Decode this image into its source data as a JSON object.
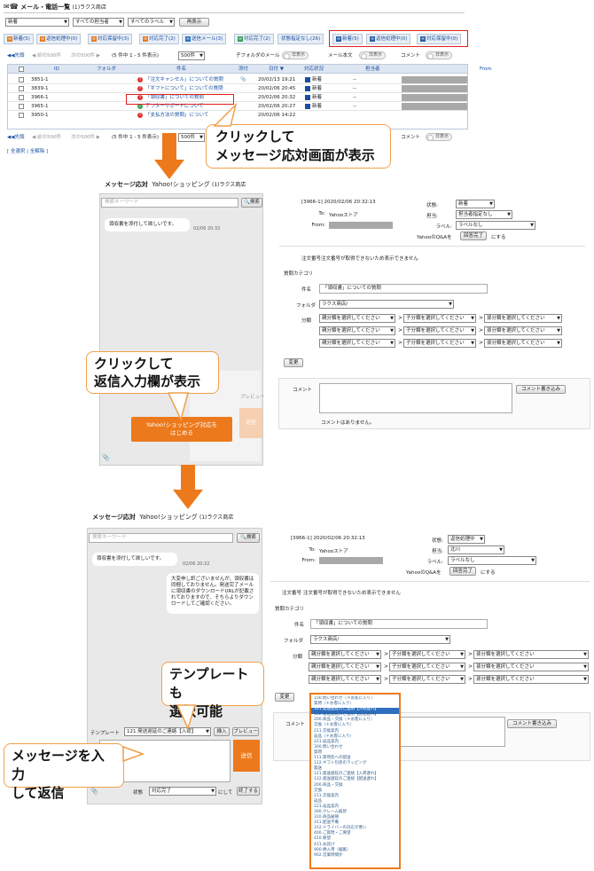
{
  "header": {
    "title": "メール・電話一覧",
    "shop": "(1)ラクス商店"
  },
  "filters": {
    "category": "新着",
    "assignee": "すべての担当者",
    "label": "すべてのラベル",
    "redisplay": "再表示"
  },
  "tabs": [
    {
      "label": "新着(5)"
    },
    {
      "label": "返信処理中(0)"
    },
    {
      "label": "対応保留中(3)"
    },
    {
      "label": "対応完了(2)"
    },
    {
      "label": "送信メール(3)"
    },
    {
      "label": "対応完了(2)"
    },
    {
      "label": "状態指定なし(26)"
    },
    {
      "label": "新着(5)"
    },
    {
      "label": "返信処理中(0)"
    },
    {
      "label": "対応保留中(0)"
    }
  ],
  "pager": {
    "first": "先頭",
    "prev": "前の500件",
    "next": "次の500件",
    "range": "(5 件中 1 - 5 件表示)",
    "per_page": "500件",
    "subfolder": "子フォルダのメール",
    "body_label": "メール本文",
    "comment_label": "コメント",
    "hidden": "非表示"
  },
  "table": {
    "headers": [
      "ID",
      "フォルダ",
      "件名",
      "添付",
      "日付 ▼",
      "対応状況",
      "担当者",
      "From"
    ],
    "rows": [
      {
        "id": "3851-1",
        "subject": "「注文キャンセル」についての質問",
        "date": "20/02/13 19:21",
        "status": "新着",
        "assignee": "--"
      },
      {
        "id": "3839-1",
        "subject": "「ギフトについて」についての質問",
        "date": "20/02/06 20:45",
        "status": "新着",
        "assignee": "--"
      },
      {
        "id": "3966-1",
        "subject": "「領収書」についての質問",
        "date": "20/02/06 20:32",
        "status": "新着",
        "assignee": "--"
      },
      {
        "id": "3965-1",
        "subject": "アフターサポートについて",
        "date": "20/02/06 20:27",
        "status": "新着",
        "assignee": "--"
      },
      {
        "id": "3950-1",
        "subject": "「支払方法の質問」について",
        "date": "20/02/06 14:22",
        "status": "新着",
        "assignee": "--"
      }
    ]
  },
  "select_links": "[ 全選択 | 全解除 ]",
  "callouts": {
    "c1": "クリックして\nメッセージ応対画面が表示",
    "c2": "クリックして\n返信入力欄が表示",
    "c3": "テンプレートも\n選択可能",
    "c4": "メッセージを入力\nして返信"
  },
  "panel1": {
    "title": "メッセージ応対",
    "store": "Yahoo!ショッピング",
    "shop": "(1)ラクス商店",
    "search_placeholder": "検索キーワード",
    "search_btn": "検索",
    "customer_msg": "領収書を添付して欲しいです。",
    "msg_time": "02/06 20:32",
    "start_btn": "Yahoo!ショッピング対応を\nはじめる",
    "tpl_btn": "挿入",
    "preview_btn": "プレビュー",
    "send_btn": "送信"
  },
  "detail1": {
    "id_date": "[3966-1]  2020/02/06 20:32:13",
    "to_label": "To:",
    "to": "Yahooストア",
    "from_label": "From:",
    "status_label": "状態:",
    "status": "新着",
    "assignee_label": "担当:",
    "assignee": "担当者指定なし",
    "label_label": "ラベル:",
    "label": "ラベルなし",
    "qa_label": "YahooのQ&Aを",
    "qa_btn": "回答完了",
    "qa_suffix": "にする",
    "order_label": "注文番号",
    "order_msg": "注文番号が取得できないため表示できません",
    "category_title": "質問カテゴリ",
    "subject_label": "件名",
    "subject": "「領収書」についての質問",
    "folder_label": "フォルダ",
    "folder": "ラクス商店/",
    "class_label": "分類",
    "major": "親分類を選択してください",
    "minor": "子分類を選択してください",
    "grand": "孫分類を選択してください",
    "change_btn": "変更",
    "comment_label": "コメント",
    "comment_btn": "コメント書き込み",
    "no_comment": "コメントはありません。"
  },
  "panel2": {
    "title": "メッセージ応対",
    "store": "Yahoo!ショッピング",
    "shop": "(1)ラクス商店",
    "search_placeholder": "検索キーワード",
    "search_btn": "検索",
    "customer_msg": "領収書を添付して欲しいです。",
    "msg_time": "02/06 20:32",
    "reply_msg": "大変申し訳ございませんが、領収書は同梱しておりません。発送完了メールに領収書のダウンロードURLが記載されておりますので、そちらよりダウンロードしてご確認ください。",
    "template_label": "テンプレート",
    "template_value": "121.発送遅延のご連絡【入荷】",
    "insert_btn": "挿入",
    "preview_btn": "プレビュー",
    "send_btn": "送信",
    "status_label": "状態",
    "status_value": "対応完了",
    "status_suffix": "にして",
    "finish_btn": "終了する"
  },
  "detail2": {
    "id_date": "[3966-1]  2020/02/06 20:32:13",
    "to_label": "To:",
    "to": "Yahooストア",
    "from_label": "From:",
    "status_label": "状態:",
    "status": "返信処理中",
    "assignee_label": "担当:",
    "assignee": "北川",
    "label_label": "ラベル:",
    "label": "ラベルなし",
    "qa_label": "YahooのQ&Aを",
    "qa_btn": "回答完了",
    "qa_suffix": "にする",
    "order_label": "注文番号",
    "order_msg": "注文番号が取得できないため表示できません",
    "category_title": "質問カテゴリ",
    "subject_label": "件名",
    "subject": "「領収書」についての質問",
    "folder_label": "フォルダ",
    "folder": "ラクス商店/",
    "class_label": "分類",
    "major": "親分類を選択してください",
    "minor": "子分類を選択してください",
    "grand": "孫分類を選択してください",
    "change_btn": "変更",
    "comment_label": "コメント",
    "comment_btn": "コメント書き込み"
  },
  "template_options": [
    "100.問い合わせ（＊お客に入り）",
    "質問（＊お客に入り）",
    "121.発送遅延のご連絡【入荷遅れ】",
    "122.発送遅延のご連絡【配送遅れ】",
    "200.商品・交換（＊お客に入り）",
    "交換（＊お客に入り）",
    "211.交換案内",
    "返品（＊お客に入り）",
    "221.返品案内",
    "300.問い合わせ",
    "質問",
    "111.質問先への配送",
    "112.ギフト包装のラッピング",
    "発送",
    "121.発送遅延のご連絡【入荷遅れ】",
    "122.発送遅延のご連絡【配送遅れ】",
    "200.商品・交換",
    "交換",
    "211.交換案内",
    "返品",
    "221.返品案内",
    "300.クレーム挨拶",
    "310.商品破損",
    "311.配送不備",
    "312.ドライバーの対応が悪い",
    "400.ご質問・ご要望",
    "410.要望",
    "411.お詫び",
    "900.挿入用（編集）",
    "902.営業時間外"
  ]
}
